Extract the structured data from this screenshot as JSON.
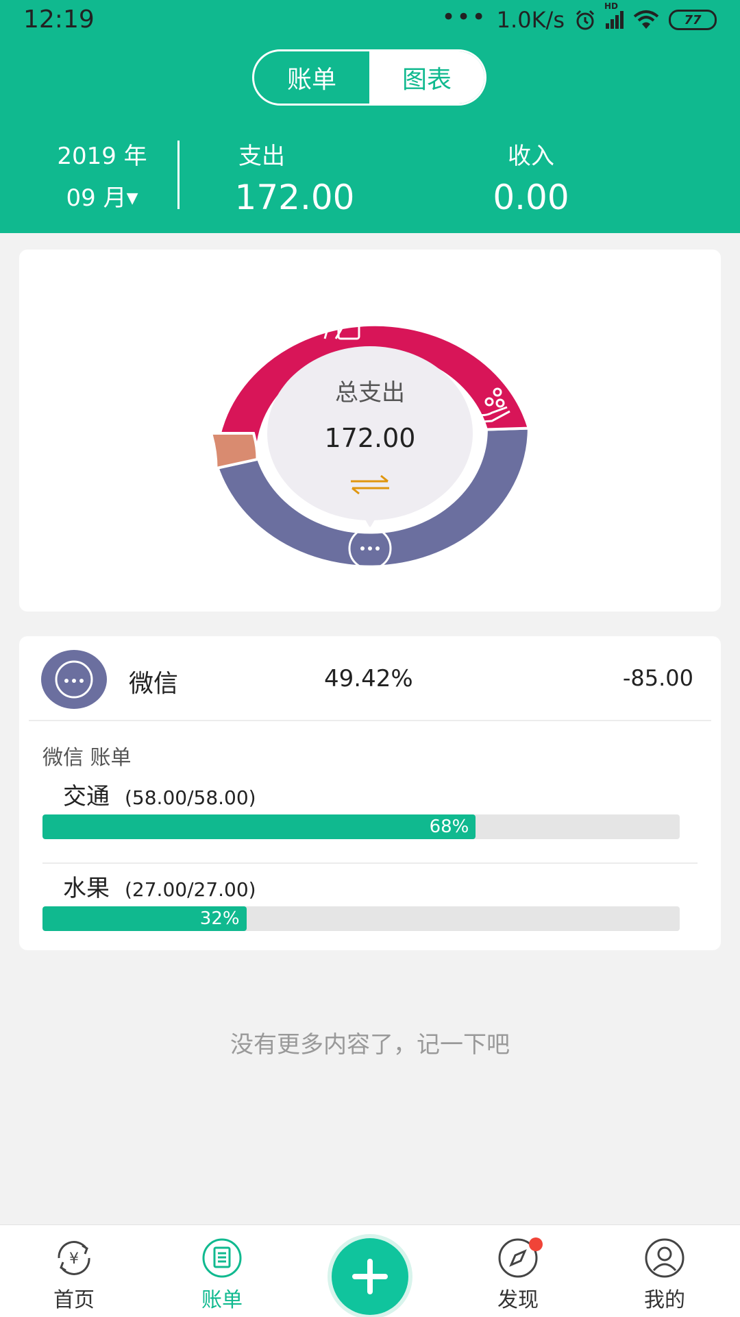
{
  "status_bar": {
    "time": "12:19",
    "network_speed": "1.0K/s",
    "signal_tag": "HD",
    "battery": "77"
  },
  "header": {
    "tabs": [
      {
        "label": "账单",
        "active": false
      },
      {
        "label": "图表",
        "active": true
      }
    ],
    "year": "2019 年",
    "month": "09 月",
    "expense_label": "支出",
    "expense_value": "172.00",
    "income_label": "收入",
    "income_value": "0.00",
    "accent_color": "#10b98f"
  },
  "chart_data": {
    "type": "pie",
    "center_label": "总支出",
    "center_value": "172.00",
    "slices": [
      {
        "icon": "more-icon",
        "value": 85.0,
        "percent": 49.42,
        "color": "#6b6f9f"
      },
      {
        "icon": "card-hand-icon",
        "value": 80.0,
        "percent": 46.51,
        "color": "#d81558"
      },
      {
        "icon": "hand-coins-icon",
        "value": 7.0,
        "percent": 4.07,
        "color": "#d98b70"
      }
    ]
  },
  "detail": {
    "category_name": "微信",
    "category_percent": "49.42%",
    "category_amount": "-85.00",
    "section_title": "微信 账单",
    "items": [
      {
        "name": "交通",
        "amounts": "(58.00/58.00)",
        "percent_label": "68%",
        "percent": 0.68
      },
      {
        "name": "水果",
        "amounts": "(27.00/27.00)",
        "percent_label": "32%",
        "percent": 0.32
      }
    ]
  },
  "empty_note": "没有更多内容了，记一下吧",
  "bottom_nav": {
    "items": [
      {
        "label": "首页",
        "icon": "yuan-refresh-icon",
        "active": false
      },
      {
        "label": "账单",
        "icon": "bill-icon",
        "active": true
      },
      {
        "label": "",
        "icon": "plus-icon",
        "active": false
      },
      {
        "label": "发现",
        "icon": "compass-icon",
        "active": false,
        "badge": true
      },
      {
        "label": "我的",
        "icon": "person-icon",
        "active": false
      }
    ]
  }
}
